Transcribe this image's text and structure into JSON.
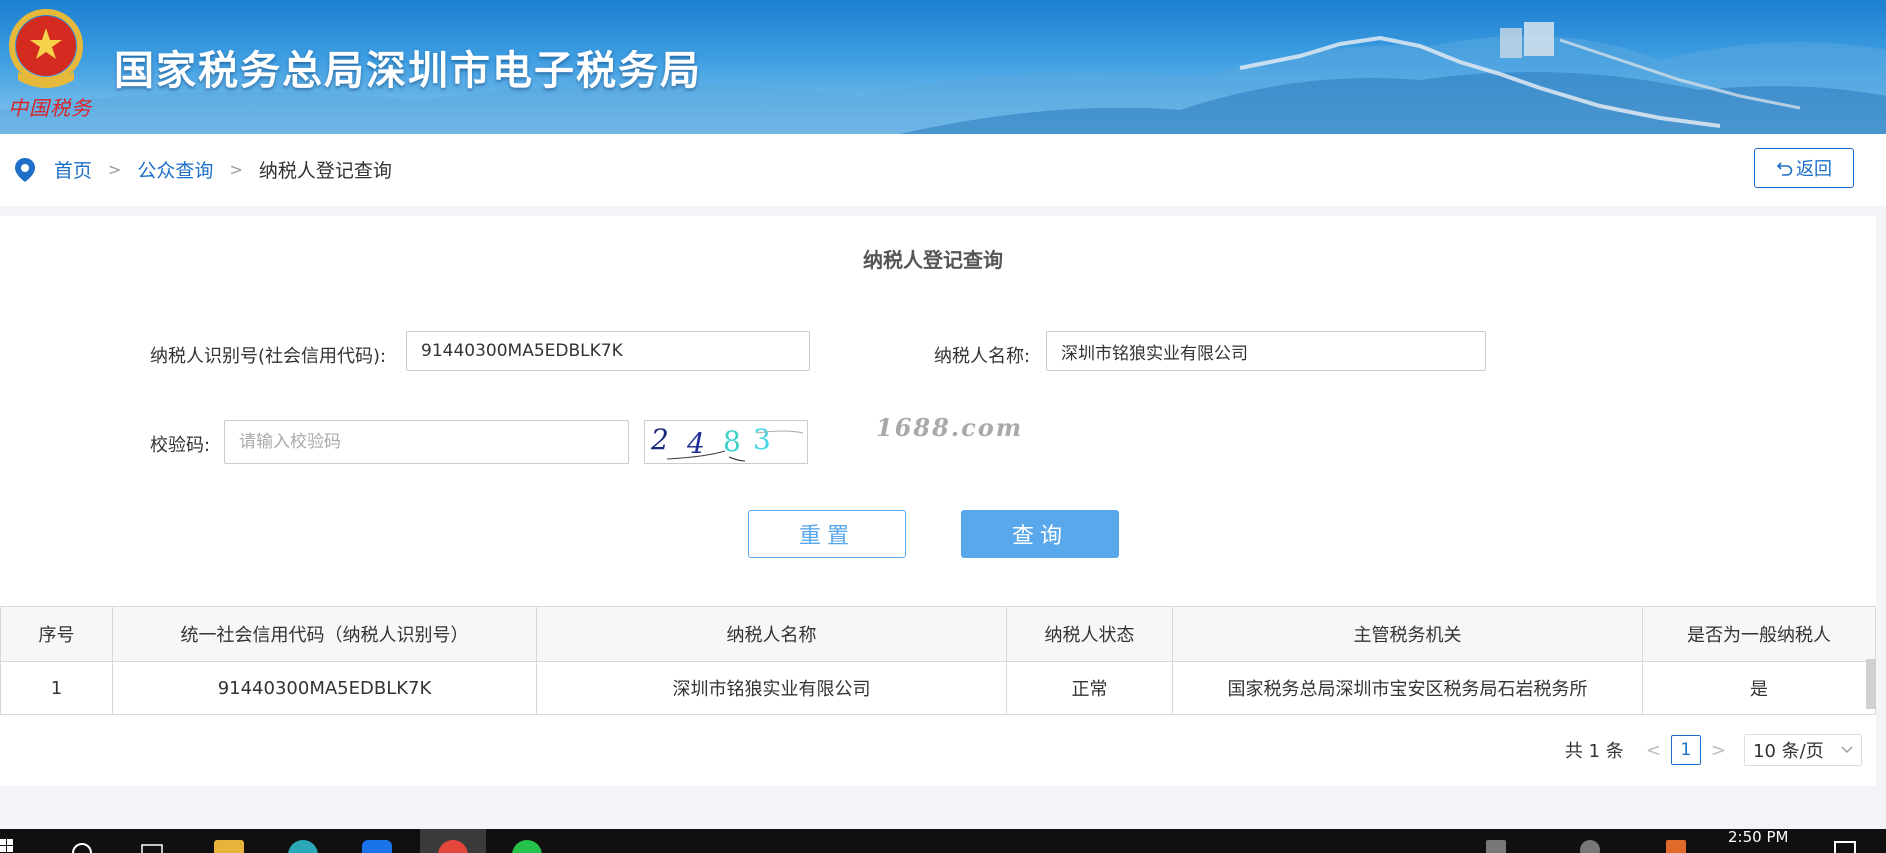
{
  "header": {
    "site_title": "国家税务总局深圳市电子税务局",
    "brand_script": "中国税务"
  },
  "breadcrumb": {
    "home": "首页",
    "separator": ">",
    "public_query": "公众查询",
    "current": "纳税人登记查询"
  },
  "back_button": {
    "icon": "undo-arrow-icon",
    "label": "返回"
  },
  "form": {
    "title": "纳税人登记查询",
    "taxpayer_id_label": "纳税人识别号(社会信用代码):",
    "taxpayer_id_value": "91440300MA5EDBLK7K",
    "taxpayer_name_label": "纳税人名称:",
    "taxpayer_name_value": "深圳市铭狼实业有限公司",
    "captcha_label": "校验码:",
    "captcha_placeholder": "请输入校验码",
    "captcha_text": "2483",
    "watermark": "1688.com",
    "reset_label": "重置",
    "query_label": "查询"
  },
  "table": {
    "headers": [
      "序号",
      "统一社会信用代码（纳税人识别号）",
      "纳税人名称",
      "纳税人状态",
      "主管税务机关",
      "是否为一般纳税人"
    ],
    "rows": [
      [
        "1",
        "91440300MA5EDBLK7K",
        "深圳市铭狼实业有限公司",
        "正常",
        "国家税务总局深圳市宝安区税务局石岩税务所",
        "是"
      ]
    ]
  },
  "pagination": {
    "total": "共 1 条",
    "prev": "<",
    "current_page": "1",
    "next": ">",
    "page_size": "10 条/页"
  },
  "taskbar": {
    "time": "2:50 PM"
  },
  "colors": {
    "primary": "#1e6fc7",
    "button_blue": "#5aa8ec",
    "banner_top": "#1c7fd0",
    "taskbar": "#101010"
  }
}
